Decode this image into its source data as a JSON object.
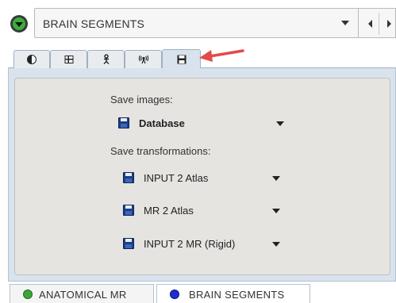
{
  "header": {
    "mode_icon": "green-circle-dropdown-icon",
    "segment_select_value": "BRAIN SEGMENTS"
  },
  "tabs": [
    {
      "icon": "contrast-icon"
    },
    {
      "icon": "grid-icon"
    },
    {
      "icon": "figure-icon"
    },
    {
      "icon": "radiate-icon"
    },
    {
      "icon": "save-disk-icon",
      "active": true
    }
  ],
  "save_panel": {
    "save_images_label": "Save images:",
    "save_images_value": "Database",
    "save_transformations_label": "Save transformations:",
    "transformations": [
      {
        "label": "INPUT 2 Atlas"
      },
      {
        "label": "MR 2 Atlas"
      },
      {
        "label": "INPUT 2 MR (Rigid)"
      }
    ]
  },
  "bottom_tabs": [
    {
      "label": "ANATOMICAL MR",
      "color": "#3aa63a"
    },
    {
      "label": "BRAIN SEGMENTS",
      "color": "#1f2fd0"
    }
  ],
  "colors": {
    "accent_arrow": "#e24a4a",
    "panel_blue": "#d8e3ee",
    "disk_blue": "#1d3f86"
  }
}
